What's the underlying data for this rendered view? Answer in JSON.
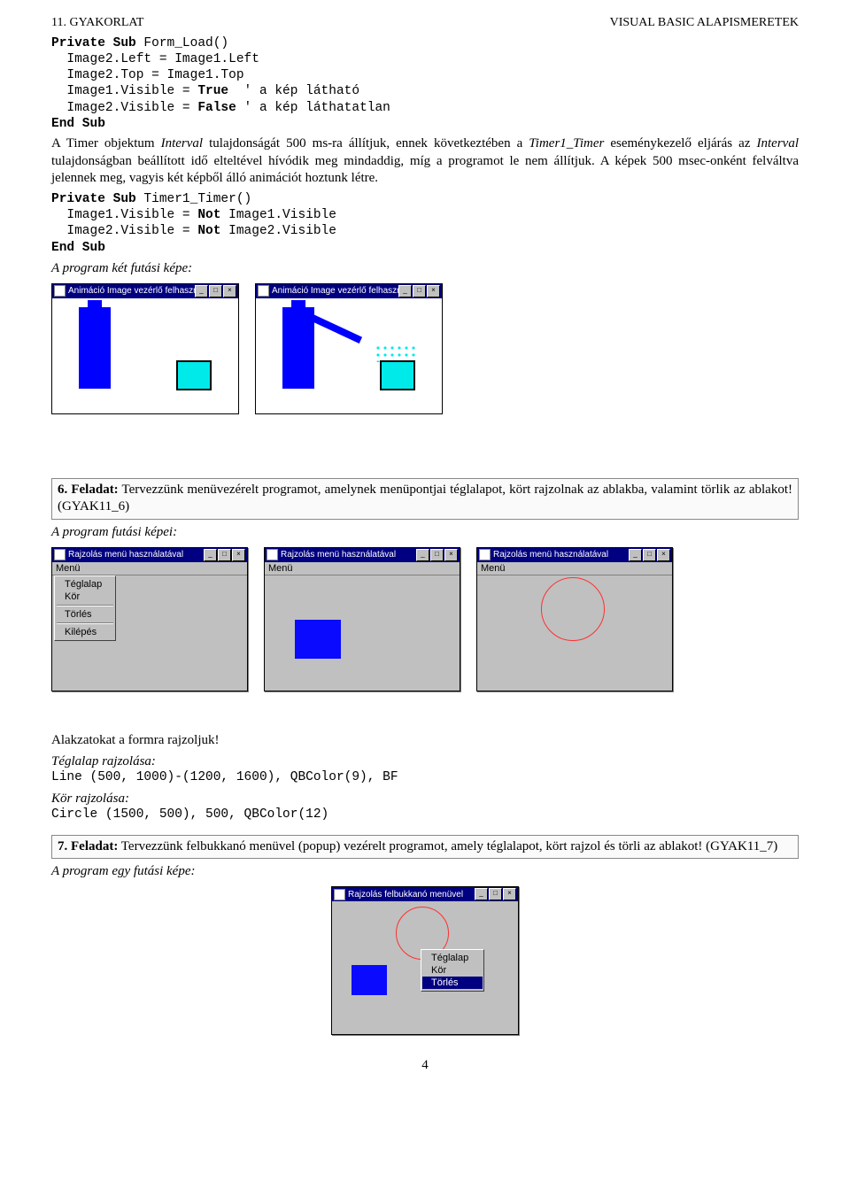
{
  "header": {
    "left": "11. GYAKORLAT",
    "right": "VISUAL BASIC ALAPISMERETEK"
  },
  "code1": {
    "l1a": "Private Sub ",
    "l1b": "Form_Load()",
    "l2": "  Image2.Left = Image1.Left",
    "l3": "  Image2.Top = Image1.Top",
    "l4a": "  Image1.Visible = ",
    "l4b": "True",
    "l4c": "  ' a kép látható",
    "l5a": "  Image2.Visible = ",
    "l5b": "False",
    "l5c": " ' a kép láthatatlan",
    "l6": "End Sub"
  },
  "para1": {
    "t1": "A Timer objektum ",
    "it1": "Interval",
    "t2": " tulajdonságát 500 ms-ra állítjuk, ennek következtében a ",
    "it2": "Timer1_Timer",
    "t3": " eseménykezelő eljárás az ",
    "it3": "Interval",
    "t4": " tulajdonságban beállított idő elteltével hívódik meg mindaddig, míg a programot le nem állítjuk. A képek 500 msec-onként felváltva jelennek meg, vagyis két képből álló animációt hoztunk létre."
  },
  "code2": {
    "l1a": "Private Sub ",
    "l1b": "Timer1_Timer()",
    "l2a": "  Image1.Visible = ",
    "l2b": "Not ",
    "l2c": "Image1.Visible",
    "l3a": "  Image2.Visible = ",
    "l3b": "Not ",
    "l3c": "Image2.Visible",
    "l4": "End Sub"
  },
  "run1": "A program két futási képe:",
  "animWin": {
    "title": "Animáció Image vezérlő felhasználásával"
  },
  "task6": {
    "b": "6. Feladat:",
    "rest": " Tervezzünk menüvezérelt programot, amelynek menüpontjai téglalapot, kört rajzolnak az ablakba, valamint törlik az ablakot! (GYAK11_6)"
  },
  "run2": "A program futási képei:",
  "drawWin": {
    "title": "Rajzolás menü használatával",
    "menu": "Menü"
  },
  "menuItems": {
    "i1": "Téglalap",
    "i2": "Kör",
    "i3": "Törlés",
    "i4": "Kilépés"
  },
  "shapes": "Alakzatokat a formra rajzoljuk!",
  "rect": {
    "title": "Téglalap rajzolása:",
    "code": "Line (500, 1000)-(1200, 1600), QBColor(9), BF"
  },
  "circ": {
    "title": "Kör rajzolása:",
    "code": "Circle (1500, 500), 500, QBColor(12)"
  },
  "task7": {
    "b": "7. Feladat:",
    "rest": " Tervezzünk felbukkanó menüvel (popup) vezérelt programot, amely téglalapot, kört rajzol és törli az ablakot! (GYAK11_7)"
  },
  "run3": "A program egy futási képe:",
  "popupWin": {
    "title": "Rajzolás felbukkanó menüvel"
  },
  "popupItems": {
    "i1": "Téglalap",
    "i2": "Kör",
    "i3": "Törlés"
  },
  "pagenum": "4"
}
